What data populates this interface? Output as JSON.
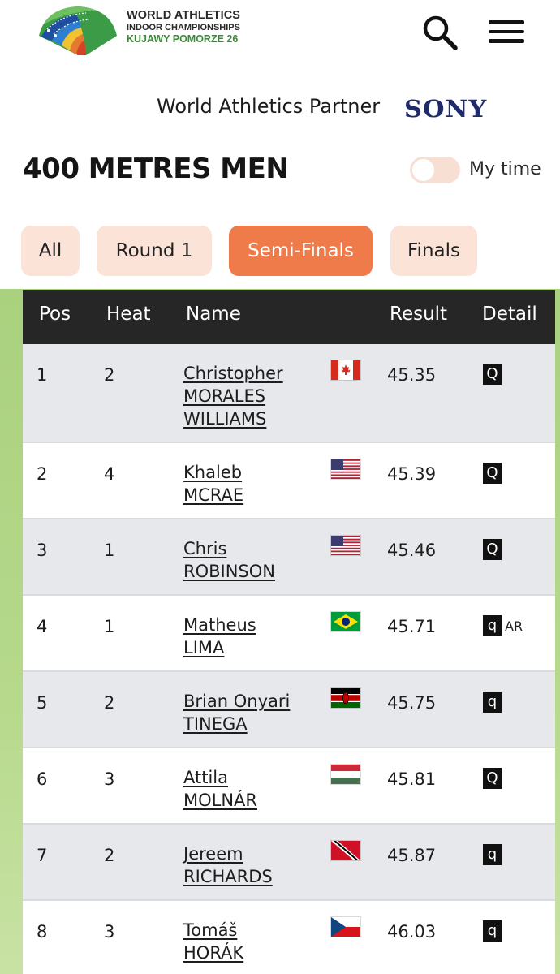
{
  "header": {
    "logo_line1": "WORLD ATHLETICS",
    "logo_line2": "INDOOR CHAMPIONSHIPS",
    "logo_line3": "KUJAWY POMORZE 26",
    "search_icon": "search-icon",
    "menu_icon": "hamburger-menu-icon"
  },
  "partner": {
    "label": "World Athletics Partner",
    "brand": "SONY"
  },
  "page_title": "400 METRES MEN",
  "my_time": {
    "label": "My time",
    "enabled": false
  },
  "tabs": [
    {
      "label": "All",
      "active": false
    },
    {
      "label": "Round 1",
      "active": false
    },
    {
      "label": "Semi-Finals",
      "active": true
    },
    {
      "label": "Finals",
      "active": false
    }
  ],
  "table": {
    "headers": {
      "pos": "Pos",
      "heat": "Heat",
      "name": "Name",
      "result": "Result",
      "detail": "Detail"
    },
    "rows": [
      {
        "pos": "1",
        "heat": "2",
        "name": [
          "Christopher",
          "MORALES",
          "WILLIAMS"
        ],
        "flag": "canada-flag",
        "result": "45.35",
        "badge": "Q",
        "extra": ""
      },
      {
        "pos": "2",
        "heat": "4",
        "name": [
          "Khaleb",
          "MCRAE"
        ],
        "flag": "usa-flag",
        "result": "45.39",
        "badge": "Q",
        "extra": ""
      },
      {
        "pos": "3",
        "heat": "1",
        "name": [
          "Chris",
          "ROBINSON"
        ],
        "flag": "usa-flag",
        "result": "45.46",
        "badge": "Q",
        "extra": ""
      },
      {
        "pos": "4",
        "heat": "1",
        "name": [
          "Matheus",
          "LIMA"
        ],
        "flag": "brazil-flag",
        "result": "45.71",
        "badge": "q",
        "extra": "AR"
      },
      {
        "pos": "5",
        "heat": "2",
        "name": [
          "Brian Onyari",
          "TINEGA"
        ],
        "flag": "kenya-flag",
        "result": "45.75",
        "badge": "q",
        "extra": ""
      },
      {
        "pos": "6",
        "heat": "3",
        "name": [
          "Attila",
          "MOLNÁR"
        ],
        "flag": "hungary-flag",
        "result": "45.81",
        "badge": "Q",
        "extra": ""
      },
      {
        "pos": "7",
        "heat": "2",
        "name": [
          "Jereem",
          "RICHARDS"
        ],
        "flag": "trinidad-and-tobago-flag",
        "result": "45.87",
        "badge": "q",
        "extra": ""
      },
      {
        "pos": "8",
        "heat": "3",
        "name": [
          "Tomáš",
          "HORÁK"
        ],
        "flag": "czech-flag",
        "result": "46.03",
        "badge": "q",
        "extra": ""
      }
    ]
  },
  "colors": {
    "accent": "#ef7b4a",
    "tab_bg": "#fbe3d8",
    "header_bg": "#262626",
    "row_alt": "#e6e8ec",
    "side_green": "#b6d98c",
    "sony_blue": "#1f2a6b"
  }
}
